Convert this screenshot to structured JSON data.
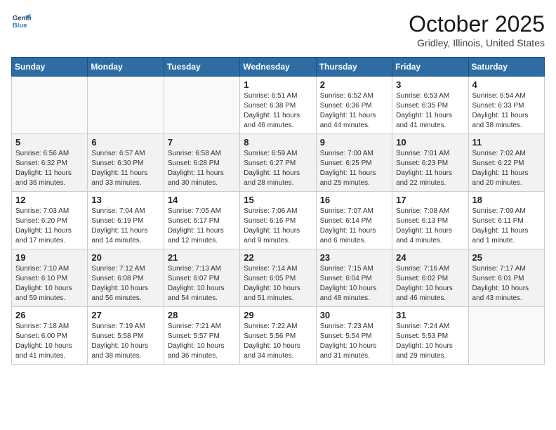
{
  "header": {
    "logo_line1": "General",
    "logo_line2": "Blue",
    "month": "October 2025",
    "location": "Gridley, Illinois, United States"
  },
  "weekdays": [
    "Sunday",
    "Monday",
    "Tuesday",
    "Wednesday",
    "Thursday",
    "Friday",
    "Saturday"
  ],
  "weeks": [
    [
      {
        "day": "",
        "info": ""
      },
      {
        "day": "",
        "info": ""
      },
      {
        "day": "",
        "info": ""
      },
      {
        "day": "1",
        "info": "Sunrise: 6:51 AM\nSunset: 6:38 PM\nDaylight: 11 hours\nand 46 minutes."
      },
      {
        "day": "2",
        "info": "Sunrise: 6:52 AM\nSunset: 6:36 PM\nDaylight: 11 hours\nand 44 minutes."
      },
      {
        "day": "3",
        "info": "Sunrise: 6:53 AM\nSunset: 6:35 PM\nDaylight: 11 hours\nand 41 minutes."
      },
      {
        "day": "4",
        "info": "Sunrise: 6:54 AM\nSunset: 6:33 PM\nDaylight: 11 hours\nand 38 minutes."
      }
    ],
    [
      {
        "day": "5",
        "info": "Sunrise: 6:56 AM\nSunset: 6:32 PM\nDaylight: 11 hours\nand 36 minutes."
      },
      {
        "day": "6",
        "info": "Sunrise: 6:57 AM\nSunset: 6:30 PM\nDaylight: 11 hours\nand 33 minutes."
      },
      {
        "day": "7",
        "info": "Sunrise: 6:58 AM\nSunset: 6:28 PM\nDaylight: 11 hours\nand 30 minutes."
      },
      {
        "day": "8",
        "info": "Sunrise: 6:59 AM\nSunset: 6:27 PM\nDaylight: 11 hours\nand 28 minutes."
      },
      {
        "day": "9",
        "info": "Sunrise: 7:00 AM\nSunset: 6:25 PM\nDaylight: 11 hours\nand 25 minutes."
      },
      {
        "day": "10",
        "info": "Sunrise: 7:01 AM\nSunset: 6:23 PM\nDaylight: 11 hours\nand 22 minutes."
      },
      {
        "day": "11",
        "info": "Sunrise: 7:02 AM\nSunset: 6:22 PM\nDaylight: 11 hours\nand 20 minutes."
      }
    ],
    [
      {
        "day": "12",
        "info": "Sunrise: 7:03 AM\nSunset: 6:20 PM\nDaylight: 11 hours\nand 17 minutes."
      },
      {
        "day": "13",
        "info": "Sunrise: 7:04 AM\nSunset: 6:19 PM\nDaylight: 11 hours\nand 14 minutes."
      },
      {
        "day": "14",
        "info": "Sunrise: 7:05 AM\nSunset: 6:17 PM\nDaylight: 11 hours\nand 12 minutes."
      },
      {
        "day": "15",
        "info": "Sunrise: 7:06 AM\nSunset: 6:16 PM\nDaylight: 11 hours\nand 9 minutes."
      },
      {
        "day": "16",
        "info": "Sunrise: 7:07 AM\nSunset: 6:14 PM\nDaylight: 11 hours\nand 6 minutes."
      },
      {
        "day": "17",
        "info": "Sunrise: 7:08 AM\nSunset: 6:13 PM\nDaylight: 11 hours\nand 4 minutes."
      },
      {
        "day": "18",
        "info": "Sunrise: 7:09 AM\nSunset: 6:11 PM\nDaylight: 11 hours\nand 1 minute."
      }
    ],
    [
      {
        "day": "19",
        "info": "Sunrise: 7:10 AM\nSunset: 6:10 PM\nDaylight: 10 hours\nand 59 minutes."
      },
      {
        "day": "20",
        "info": "Sunrise: 7:12 AM\nSunset: 6:08 PM\nDaylight: 10 hours\nand 56 minutes."
      },
      {
        "day": "21",
        "info": "Sunrise: 7:13 AM\nSunset: 6:07 PM\nDaylight: 10 hours\nand 54 minutes."
      },
      {
        "day": "22",
        "info": "Sunrise: 7:14 AM\nSunset: 6:05 PM\nDaylight: 10 hours\nand 51 minutes."
      },
      {
        "day": "23",
        "info": "Sunrise: 7:15 AM\nSunset: 6:04 PM\nDaylight: 10 hours\nand 48 minutes."
      },
      {
        "day": "24",
        "info": "Sunrise: 7:16 AM\nSunset: 6:02 PM\nDaylight: 10 hours\nand 46 minutes."
      },
      {
        "day": "25",
        "info": "Sunrise: 7:17 AM\nSunset: 6:01 PM\nDaylight: 10 hours\nand 43 minutes."
      }
    ],
    [
      {
        "day": "26",
        "info": "Sunrise: 7:18 AM\nSunset: 6:00 PM\nDaylight: 10 hours\nand 41 minutes."
      },
      {
        "day": "27",
        "info": "Sunrise: 7:19 AM\nSunset: 5:58 PM\nDaylight: 10 hours\nand 38 minutes."
      },
      {
        "day": "28",
        "info": "Sunrise: 7:21 AM\nSunset: 5:57 PM\nDaylight: 10 hours\nand 36 minutes."
      },
      {
        "day": "29",
        "info": "Sunrise: 7:22 AM\nSunset: 5:56 PM\nDaylight: 10 hours\nand 34 minutes."
      },
      {
        "day": "30",
        "info": "Sunrise: 7:23 AM\nSunset: 5:54 PM\nDaylight: 10 hours\nand 31 minutes."
      },
      {
        "day": "31",
        "info": "Sunrise: 7:24 AM\nSunset: 5:53 PM\nDaylight: 10 hours\nand 29 minutes."
      },
      {
        "day": "",
        "info": ""
      }
    ]
  ]
}
